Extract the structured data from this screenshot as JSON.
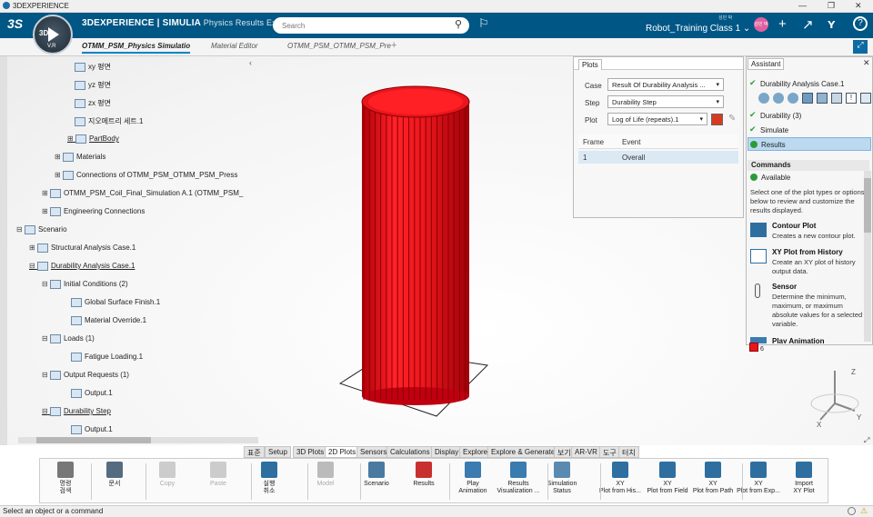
{
  "window": {
    "title": "3DEXPERIENCE"
  },
  "topbar": {
    "brand_bold": "3DEXPERIENCE | SIMULIA",
    "brand_sub": "Physics Results Expl...",
    "compass_version": "V.R",
    "search_placeholder": "Search",
    "user_small": "성민 박",
    "user_label": "Robot_Training Class 1",
    "avatar_text": "성민 박"
  },
  "tabs": [
    {
      "label": "OTMM_PSM_Physics Simulatio"
    },
    {
      "label": "Material Editor"
    },
    {
      "label": "OTMM_PSM_OTMM_PSM_Pre"
    }
  ],
  "tree": [
    {
      "label": "xy 평면",
      "ul": false
    },
    {
      "label": "yz 평면",
      "ul": false
    },
    {
      "label": "zx 평면",
      "ul": false
    },
    {
      "label": "지오메트리 세트.1",
      "ul": false
    },
    {
      "label": "PartBody",
      "ul": true
    },
    {
      "label": "Materials",
      "ul": false
    },
    {
      "label": "Connections of OTMM_PSM_OTMM_PSM_Press",
      "ul": false
    },
    {
      "label": "OTMM_PSM_Coil_Final_Simulation A.1 (OTMM_PSM_",
      "ul": false
    },
    {
      "label": "Engineering Connections",
      "ul": false
    },
    {
      "label": "Scenario",
      "ul": false
    },
    {
      "label": "Structural Analysis Case.1",
      "ul": false
    },
    {
      "label": "Durability Analysis Case.1",
      "ul": true
    },
    {
      "label": "Initial Conditions (2)",
      "ul": false
    },
    {
      "label": "Global Surface Finish.1",
      "ul": false
    },
    {
      "label": "Material Override.1",
      "ul": false
    },
    {
      "label": "Loads (1)",
      "ul": false
    },
    {
      "label": "Fatigue Loading.1",
      "ul": false
    },
    {
      "label": "Output Requests (1)",
      "ul": false
    },
    {
      "label": "Output.1",
      "ul": false
    },
    {
      "label": "Durability Step",
      "ul": true
    },
    {
      "label": "Output.1",
      "ul": false
    }
  ],
  "plots_panel": {
    "tab": "Plots",
    "case_label": "Case",
    "case_value": "Result Of Durability Analysis ...",
    "step_label": "Step",
    "step_value": "Durability Step",
    "plot_label": "Plot",
    "plot_value": "Log of Life (repeats).1",
    "col_frame": "Frame",
    "col_event": "Event",
    "row_frame": "1",
    "row_event": "Overall"
  },
  "assistant": {
    "tab": "Assistant",
    "items": [
      "Durability Analysis Case.1",
      "Durability (3)",
      "Simulate",
      "Results"
    ],
    "commands_header": "Commands",
    "available": "Available",
    "intro": "Select one of the plot types or options below to review and customize the results displayed.",
    "commands": [
      {
        "title": "Contour Plot",
        "desc": "Creates a new contour plot."
      },
      {
        "title": "XY Plot from History",
        "desc": "Create an XY plot of history output data."
      },
      {
        "title": "Sensor",
        "desc": "Determine the minimum, maximum, or maximum absolute values for a selected variable."
      },
      {
        "title": "Play Animation",
        "desc": ""
      }
    ],
    "legend_value": "6"
  },
  "bottom_tabs": [
    "표준",
    "Setup",
    "3D Plots",
    "2D Plots",
    "Sensors",
    "Calculations",
    "Display",
    "Explore",
    "Explore & Generate",
    "보기",
    "AR-VR",
    "도구",
    "터치"
  ],
  "bottom_tab_active": "2D Plots",
  "actions": [
    {
      "label": "명령\n검색",
      "icon": "command-search-icon"
    },
    {
      "label": "문서",
      "icon": "document-icon"
    },
    {
      "label": "Copy",
      "icon": "copy-icon"
    },
    {
      "label": "Paste",
      "icon": "paste-icon"
    },
    {
      "label": "실행\n취소",
      "icon": "undo-icon"
    },
    {
      "label": "Model",
      "icon": "model-icon"
    },
    {
      "label": "Scenario",
      "icon": "scenario-icon"
    },
    {
      "label": "Results",
      "icon": "results-icon"
    },
    {
      "label": "Play\nAnimation",
      "icon": "play-animation-icon"
    },
    {
      "label": "Results\nVisualization ...",
      "icon": "results-visualization-icon"
    },
    {
      "label": "Simulation\nStatus",
      "icon": "simulation-status-icon"
    },
    {
      "label": "XY\nPlot from His...",
      "icon": "xy-plot-history-icon"
    },
    {
      "label": "XY\nPlot from Field",
      "icon": "xy-plot-field-icon"
    },
    {
      "label": "XY\nPlot from Path",
      "icon": "xy-plot-path-icon"
    },
    {
      "label": "XY\nPlot from Exp...",
      "icon": "xy-plot-exp-icon"
    },
    {
      "label": "Import\nXY Plot",
      "icon": "import-xy-plot-icon"
    }
  ],
  "compass": {
    "x": "X",
    "y": "Y",
    "z": "Z"
  },
  "status_text": "Select an object or a command",
  "colors": {
    "accent": "#005685",
    "model": "#e8161c",
    "check": "#2b9b3a"
  }
}
